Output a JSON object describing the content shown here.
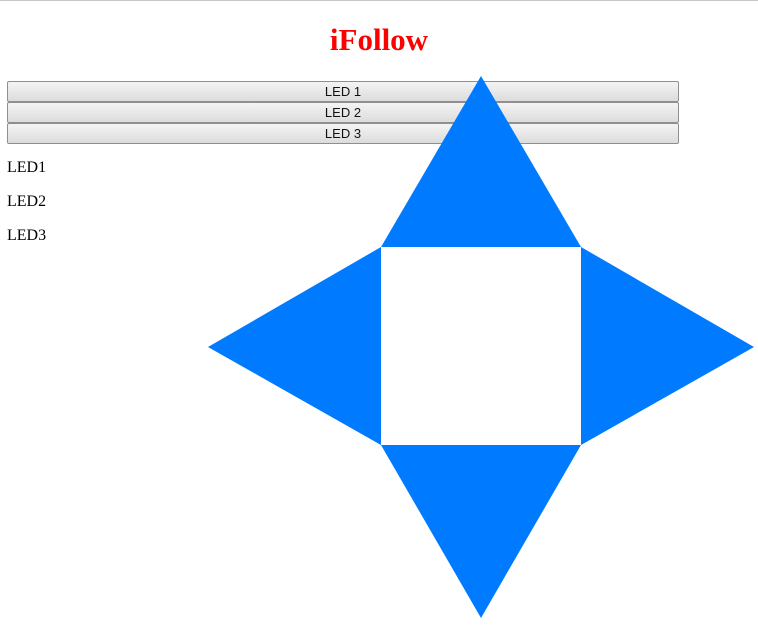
{
  "page": {
    "title": "iFollow"
  },
  "buttons": [
    {
      "label": "LED 1"
    },
    {
      "label": "LED 2"
    },
    {
      "label": "LED 3"
    }
  ],
  "status_labels": [
    {
      "text": "LED1"
    },
    {
      "text": "LED2"
    },
    {
      "text": "LED3"
    }
  ],
  "dpad": {
    "color": "#007bff",
    "arrows": [
      "up-arrow-icon",
      "left-arrow-icon",
      "right-arrow-icon",
      "down-arrow-icon"
    ]
  },
  "colors": {
    "title": "#ff0000",
    "arrow_fill": "#007bff"
  }
}
